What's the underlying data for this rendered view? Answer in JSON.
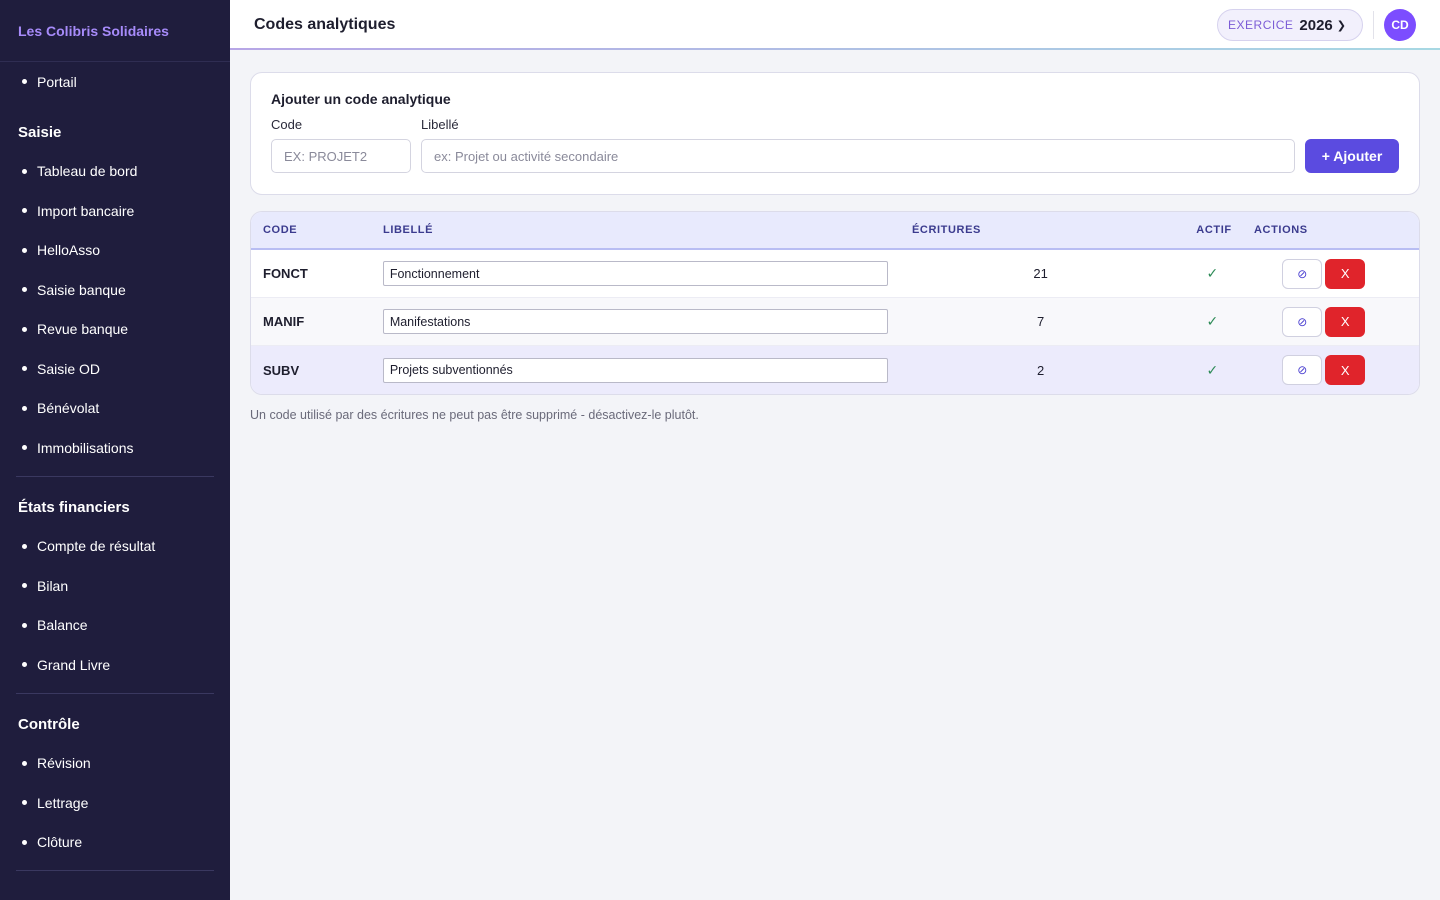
{
  "sidebar": {
    "brand": "Les Colibris Solidaires",
    "top_items": [
      "Portail"
    ],
    "groups": [
      {
        "title": "Saisie",
        "items": [
          "Tableau de bord",
          "Import bancaire",
          "HelloAsso",
          "Saisie banque",
          "Revue banque",
          "Saisie OD",
          "Bénévolat",
          "Immobilisations"
        ]
      },
      {
        "title": "États financiers",
        "items": [
          "Compte de résultat",
          "Bilan",
          "Balance",
          "Grand Livre"
        ]
      },
      {
        "title": "Contrôle",
        "items": [
          "Révision",
          "Lettrage",
          "Clôture"
        ]
      }
    ]
  },
  "header": {
    "title": "Codes analytiques",
    "exercice_label": "EXERCICE",
    "exercice_year": "2026",
    "avatar": "CD"
  },
  "add_form": {
    "title": "Ajouter un code analytique",
    "code_label": "Code",
    "libelle_label": "Libellé",
    "code_placeholder": "EX: PROJET2",
    "libelle_placeholder": "ex: Projet ou activité secondaire",
    "add_button": "+ Ajouter"
  },
  "table": {
    "columns": {
      "code": "CODE",
      "libelle": "LIBELLÉ",
      "ecritures": "ÉCRITURES",
      "actif": "ACTIF",
      "actions": "ACTIONS"
    },
    "rows": [
      {
        "code": "FONCT",
        "libelle": "Fonctionnement",
        "ecritures": "21",
        "actif": "✓",
        "deactivate": "⊘",
        "delete": "X"
      },
      {
        "code": "MANIF",
        "libelle": "Manifestations",
        "ecritures": "7",
        "actif": "✓",
        "deactivate": "⊘",
        "delete": "X"
      },
      {
        "code": "SUBV",
        "libelle": "Projets subventionnés",
        "ecritures": "2",
        "actif": "✓",
        "deactivate": "⊘",
        "delete": "X"
      }
    ]
  },
  "hint": "Un code utilisé par des écritures ne peut pas être supprimé - désactivez-le plutôt.",
  "colors": {
    "sidebar_bg": "#1f1d3d",
    "accent": "#5b4be0",
    "danger": "#e0242b",
    "brand": "#a78bfa"
  }
}
